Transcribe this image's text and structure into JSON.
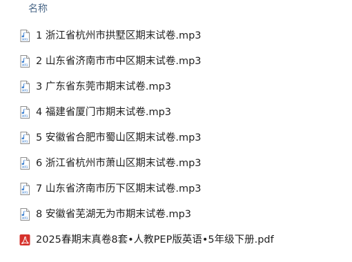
{
  "header": {
    "name_column": "名称"
  },
  "files": [
    {
      "name": "1 浙江省杭州市拱墅区期末试卷.mp3",
      "icon": "audio-file-icon"
    },
    {
      "name": "2 山东省济南市市中区期末试卷.mp3",
      "icon": "audio-file-icon"
    },
    {
      "name": "3 广东省东莞市期末试卷.mp3",
      "icon": "audio-file-icon"
    },
    {
      "name": "4 福建省厦门市期末试卷.mp3",
      "icon": "audio-file-icon"
    },
    {
      "name": "5 安徽省合肥市蜀山区期末试卷.mp3",
      "icon": "audio-file-icon"
    },
    {
      "name": "6 浙江省杭州市萧山区期末试卷.mp3",
      "icon": "audio-file-icon"
    },
    {
      "name": "7 山东省济南市历下区期末试卷.mp3",
      "icon": "audio-file-icon"
    },
    {
      "name": "8 安徽省芜湖无为市期末试卷.mp3",
      "icon": "audio-file-icon"
    },
    {
      "name": "2025春期末真卷8套•人教PEP版英语•5年级下册.pdf",
      "icon": "pdf-file-icon"
    }
  ],
  "colors": {
    "header_text": "#4d6a8a",
    "file_text": "#1f1f1f",
    "pdf_red": "#d6322c",
    "audio_blue": "#3b7fd0"
  }
}
